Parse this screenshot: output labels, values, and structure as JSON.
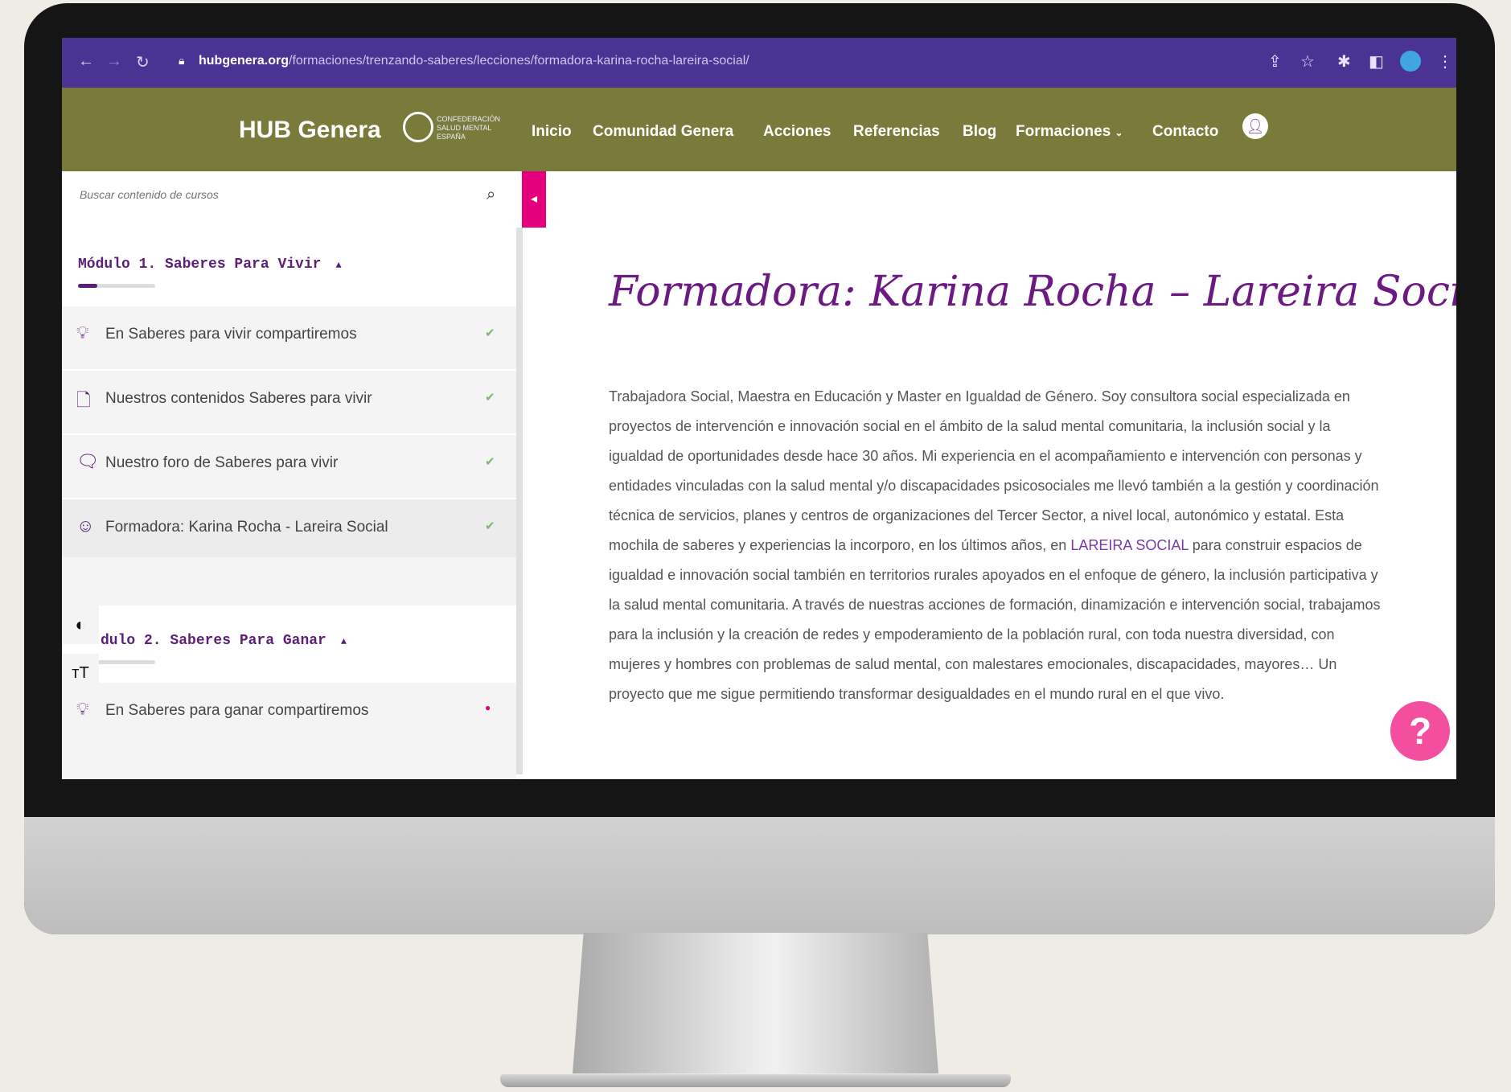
{
  "browser": {
    "url_domain": "hubgenera.org",
    "url_path": "/formaciones/trenzando-saberes/lecciones/formadora-karina-rocha-lareira-social/"
  },
  "site": {
    "brand": "HUB Genera",
    "logo_subtext": "CONFEDERACIÓN SALUD MENTAL ESPAÑA",
    "menu": [
      "Inicio",
      "Comunidad Genera",
      "Acciones",
      "Referencias",
      "Blog",
      "Formaciones",
      "Contacto"
    ]
  },
  "sidebar": {
    "search_placeholder": "Buscar contenido de cursos",
    "modules": [
      {
        "title": "Módulo 1. Saberes Para Vivir",
        "progress": 0.25,
        "lessons": [
          {
            "label": "En Saberes para vivir compartiremos",
            "icon": "lightbulb-icon",
            "done": true
          },
          {
            "label": "Nuestros contenidos Saberes para vivir",
            "icon": "document-icon",
            "done": true
          },
          {
            "label": "Nuestro foro de Saberes para vivir",
            "icon": "forum-icon",
            "done": true
          },
          {
            "label": "Formadora: Karina Rocha - Lareira Social",
            "icon": "person-icon",
            "done": true
          }
        ]
      },
      {
        "title": "dulo 2. Saberes Para Ganar",
        "progress": 0.0,
        "lessons": [
          {
            "label": "En Saberes para ganar compartiremos",
            "icon": "lightbulb-icon",
            "done": false
          }
        ]
      }
    ]
  },
  "content": {
    "heading": "Formadora: Karina Rocha – Lareira Social",
    "para_before_link": "Trabajadora Social, Maestra en Educación y Master en Igualdad de Género. Soy consultora social especializada en proyectos de intervención e innovación social en el ámbito de la salud mental comunitaria, la inclusión social y la igualdad de oportunidades desde hace 30 años. Mi experiencia en el acompañamiento e intervención con personas y entidades vinculadas con la salud mental y/o discapacidades psicosociales me llevó también a la gestión y coordinación técnica de servicios, planes y centros de organizaciones del Tercer Sector, a nivel local, autonómico y estatal. Esta mochila de saberes y experiencias la incorporo, en los últimos años, en ",
    "link_text": "LAREIRA SOCIAL",
    "para_after_link": " para construir espacios de igualdad e innovación social también en territorios rurales apoyados en el enfoque de género, la inclusión participativa y la salud mental comunitaria. A través de nuestras acciones de formación, dinamización e intervención social, trabajamos para la inclusión y la creación de redes y empoderamiento de la población rural, con toda nuestra diversidad, con mujeres y hombres con problemas de salud mental, con malestares emocionales, discapacidades, mayores… Un proyecto que me sigue permitiendo transformar desigualdades en el mundo rural en el que vivo."
  },
  "help_label": "?",
  "colors": {
    "browser_bar": "#4b3393",
    "site_nav": "#7a7a3a",
    "accent_pink": "#e4007c",
    "heading_purple": "#6b1a82"
  }
}
